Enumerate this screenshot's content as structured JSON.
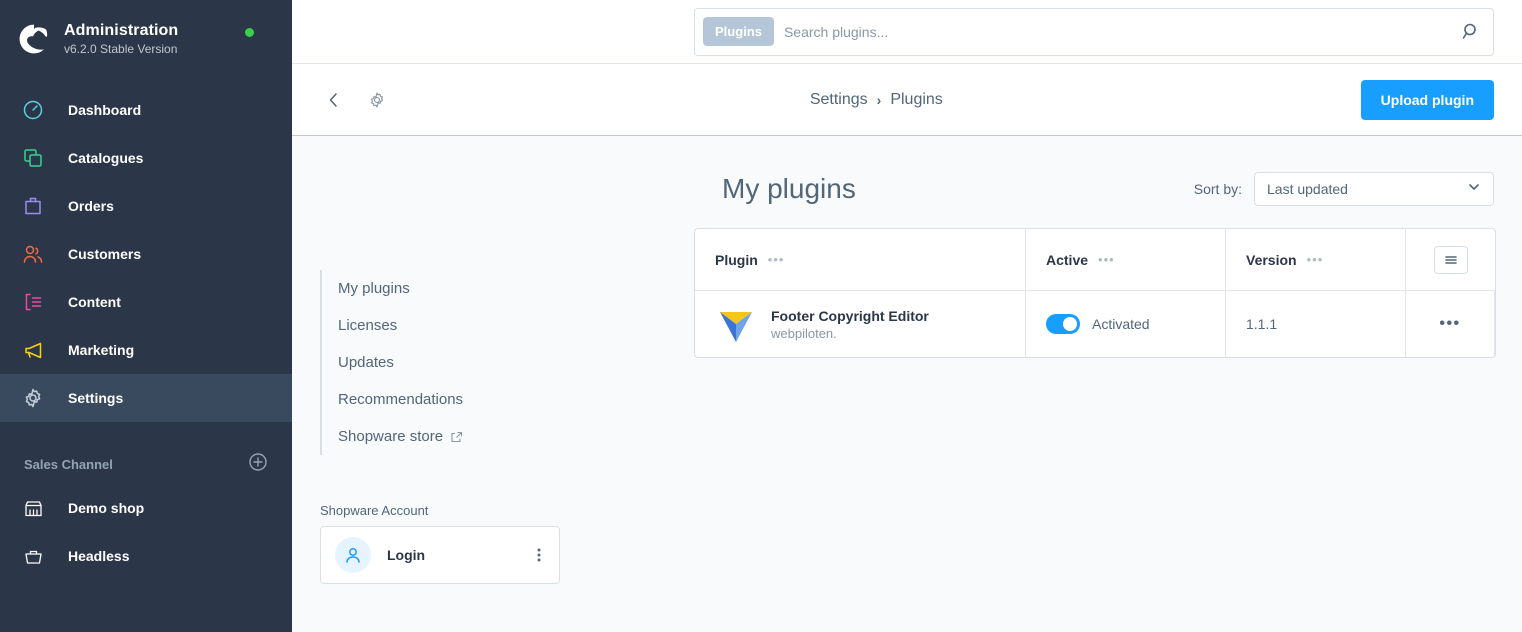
{
  "sidebar": {
    "brand": {
      "logo_icon": "shopware-logo-icon",
      "title": "Administration",
      "version": "v6.2.0 Stable Version",
      "status_dot_color": "#37d046"
    },
    "nav_items": [
      {
        "label": "Dashboard",
        "icon": "dashboard-icon",
        "color": "#5ecfe0",
        "active": false
      },
      {
        "label": "Catalogues",
        "icon": "catalogues-icon",
        "color": "#3fcf8e",
        "active": false
      },
      {
        "label": "Orders",
        "icon": "orders-icon",
        "color": "#9b8cf0",
        "active": false
      },
      {
        "label": "Customers",
        "icon": "customers-icon",
        "color": "#f06a45",
        "active": false
      },
      {
        "label": "Content",
        "icon": "content-icon",
        "color": "#ef48a4",
        "active": false
      },
      {
        "label": "Marketing",
        "icon": "marketing-icon",
        "color": "#f5d216",
        "active": false
      },
      {
        "label": "Settings",
        "icon": "gear-icon",
        "color": "#c6ced9",
        "active": true
      }
    ],
    "sales_channel": {
      "title": "Sales Channel",
      "add_icon": "plus-circle-icon",
      "items": [
        {
          "label": "Demo shop",
          "icon": "storefront-icon"
        },
        {
          "label": "Headless",
          "icon": "basket-icon"
        }
      ]
    }
  },
  "search": {
    "tag": "Plugins",
    "placeholder": "Search plugins...",
    "value": "",
    "icon": "search-icon"
  },
  "smart_bar": {
    "back_icon": "chevron-left-icon",
    "gear_icon": "gear-icon",
    "breadcrumb": [
      "Settings",
      "Plugins"
    ],
    "breadcrumb_separator": "›",
    "action_label": "Upload plugin",
    "action_color": "#189eff"
  },
  "page": {
    "title": "My plugins",
    "sort": {
      "label": "Sort by:",
      "value": "Last updated",
      "chevron_icon": "chevron-down-icon"
    }
  },
  "side_menu": {
    "items": [
      {
        "label": "My plugins",
        "external": false
      },
      {
        "label": "Licenses",
        "external": false
      },
      {
        "label": "Updates",
        "external": false
      },
      {
        "label": "Recommendations",
        "external": false
      },
      {
        "label": "Shopware store",
        "external": true,
        "external_icon": "external-link-icon"
      }
    ]
  },
  "account": {
    "label": "Shopware Account",
    "avatar_icon": "user-icon",
    "name": "Login",
    "menu_icon": "vertical-dots-icon"
  },
  "table": {
    "columns": [
      {
        "label": "Plugin",
        "dots": "•••"
      },
      {
        "label": "Active",
        "dots": "•••"
      },
      {
        "label": "Version",
        "dots": "•••"
      }
    ],
    "column_settings_icon": "column-settings-icon",
    "rows": [
      {
        "icon": "plugin-logo-icon",
        "name": "Footer Copyright Editor",
        "author": "webpiloten.",
        "active": true,
        "active_label": "Activated",
        "version": "1.1.1",
        "row_menu_icon": "horizontal-dots-icon",
        "row_menu_dots": "•••"
      }
    ]
  }
}
